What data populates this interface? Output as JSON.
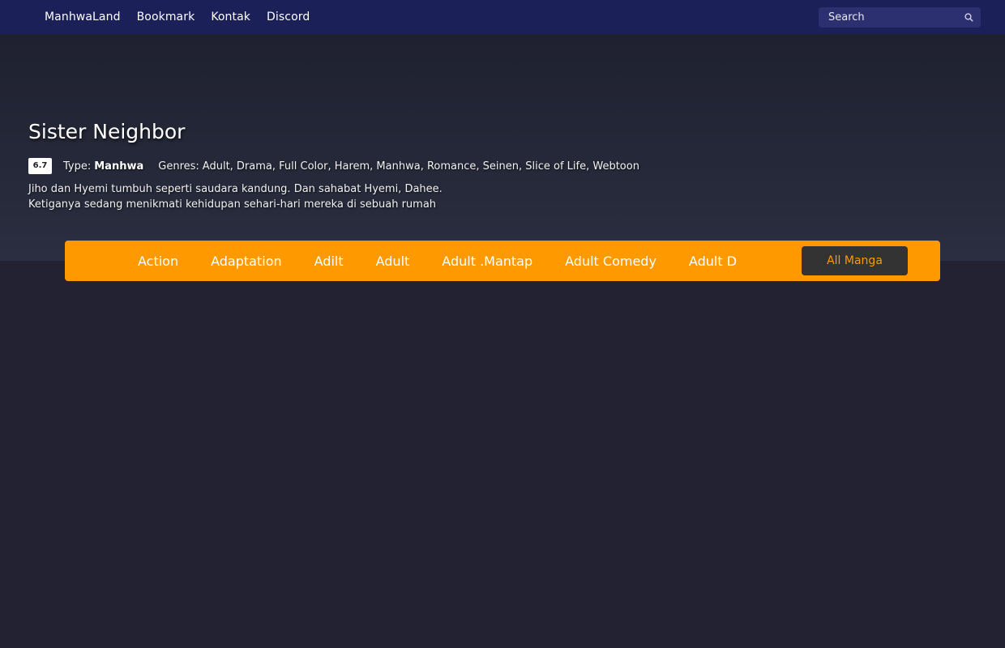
{
  "nav": {
    "items": [
      "ManhwaLand",
      "Bookmark",
      "Kontak",
      "Discord"
    ]
  },
  "search": {
    "placeholder": "Search",
    "icon": "search-icon"
  },
  "series": {
    "title": "Sister Neighbor",
    "score": "6.7",
    "type_label": "Type:",
    "type_value": "Manhwa",
    "genres_label": "Genres:",
    "genres": "Adult, Drama, Full Color, Harem, Manhwa, Romance, Seinen, Slice of Life, Webtoon",
    "synopsis_line1": "Jiho dan Hyemi tumbuh seperti saudara kandung. Dan sahabat Hyemi, Dahee.",
    "synopsis_line2": "Ketiganya sedang menikmati kehidupan sehari-hari mereka di sebuah rumah"
  },
  "genre_bar": {
    "items": [
      "Action",
      "Adaptation",
      "Adilt",
      "Adult",
      "Adult .Mantap",
      "Adult Comedy",
      "Adult D"
    ],
    "all_label": "All Manga"
  },
  "colors": {
    "topbar": "#1c2059",
    "accent": "#ff9900",
    "background": "#222233"
  }
}
